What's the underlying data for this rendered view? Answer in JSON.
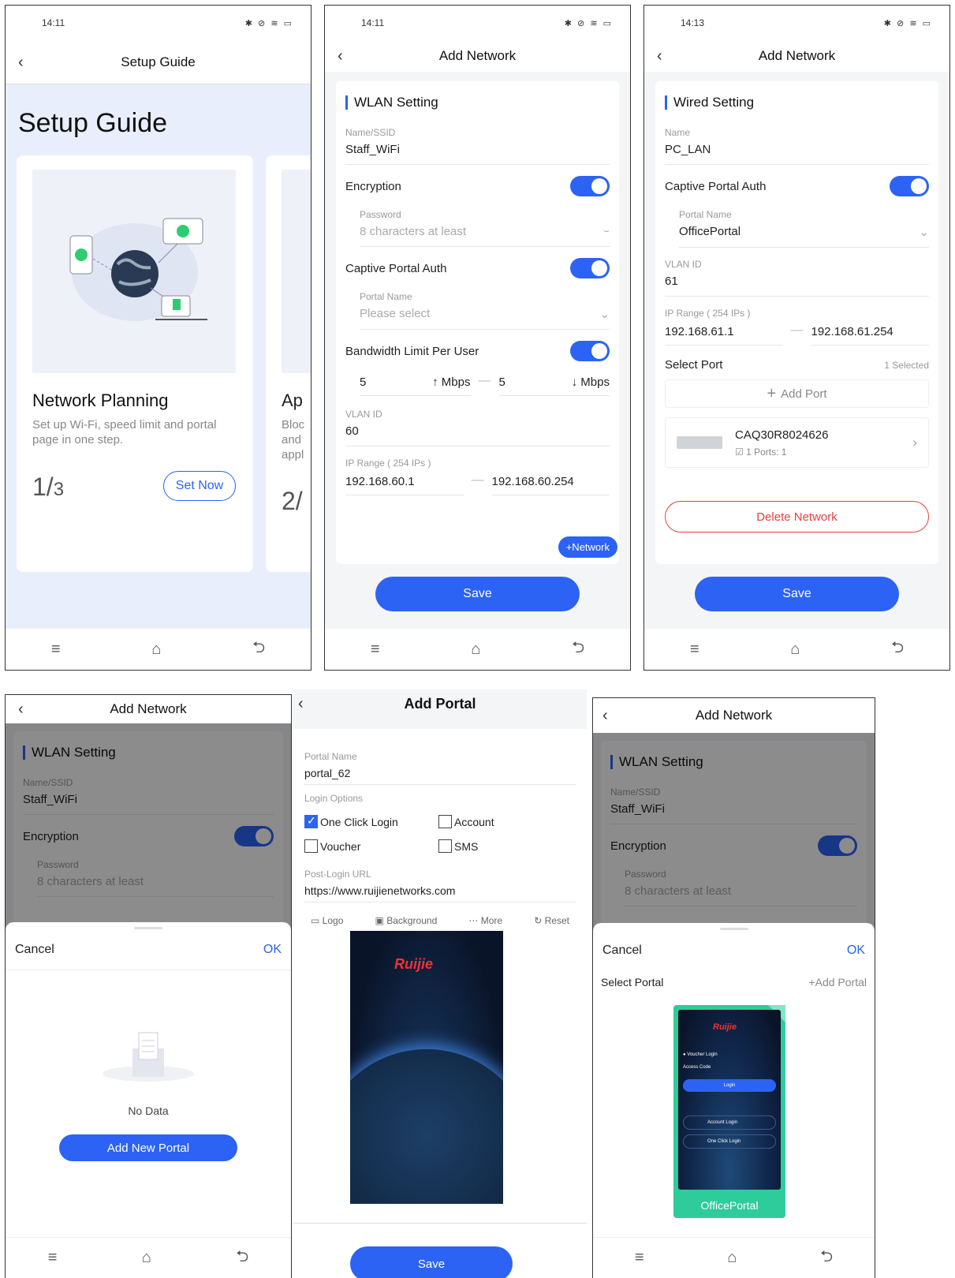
{
  "screen1": {
    "time": "14:11",
    "status_icons": "✱ ⊘ ≋ ▭",
    "title": "Setup Guide",
    "heading": "Setup Guide",
    "card_title": "Network Planning",
    "card_desc": "Set up Wi-Fi, speed limit and portal page in one step.",
    "page": "1/",
    "page_total": "3",
    "button": "Set Now",
    "card2_title": "Ap",
    "card2_desc": "Bloc and appl",
    "card2_page": "2/"
  },
  "screen2": {
    "time": "14:11",
    "status_icons": "✱ ⊘ ≋ ▭",
    "title": "Add Network",
    "section": "WLAN Setting",
    "ssid_label": "Name/SSID",
    "ssid": "Staff_WiFi",
    "encryption": "Encryption",
    "password_label": "Password",
    "password_ph": "8 characters at least",
    "captive": "Captive Portal Auth",
    "portal_label": "Portal Name",
    "portal_ph": "Please select",
    "bandwidth": "Bandwidth Limit Per User",
    "up_val": "5",
    "up_unit": "↑ Mbps",
    "down_val": "5",
    "down_unit": "↓ Mbps",
    "vlan_label": "VLAN ID",
    "vlan": "60",
    "ip_label": "IP Range ( 254  IPs )",
    "ip_start": "192.168.60.1",
    "ip_end": "192.168.60.254",
    "add_network": "+Network",
    "save": "Save"
  },
  "screen3": {
    "time": "14:13",
    "status_icons": "✱ ⊘ ≋ ▭",
    "title": "Add Network",
    "section": "Wired Setting",
    "name_label": "Name",
    "name": "PC_LAN",
    "captive": "Captive Portal Auth",
    "portal_label": "Portal Name",
    "portal": "OfficePortal",
    "vlan_label": "VLAN ID",
    "vlan": "61",
    "ip_label": "IP Range ( 254  IPs )",
    "ip_start": "192.168.61.1",
    "ip_end": "192.168.61.254",
    "select_port": "Select Port",
    "selected": "1 Selected",
    "add_port": "Add Port",
    "device": "CAQ30R8024626",
    "ports": "1 Ports: 1",
    "delete": "Delete Network",
    "save": "Save"
  },
  "screen4": {
    "title": "Add Network",
    "section": "WLAN Setting",
    "ssid_label": "Name/SSID",
    "ssid": "Staff_WiFi",
    "encryption": "Encryption",
    "password_label": "Password",
    "password_ph": "8 characters at least",
    "cancel": "Cancel",
    "ok": "OK",
    "empty": "No Data",
    "add_portal": "Add New Portal"
  },
  "screen5": {
    "title": "Add Portal",
    "portal_label": "Portal Name",
    "portal": "portal_62",
    "login_label": "Login Options",
    "opt1": "One Click Login",
    "opt2": "Account",
    "opt3": "Voucher",
    "opt4": "SMS",
    "url_label": "Post-Login URL",
    "url": "https://www.ruijienetworks.com",
    "tool1": "Logo",
    "tool2": "Background",
    "tool3": "More",
    "tool4": "Reset",
    "brand": "Ruijie",
    "save": "Save"
  },
  "screen6": {
    "title": "Add Network",
    "section": "WLAN Setting",
    "ssid_label": "Name/SSID",
    "ssid": "Staff_WiFi",
    "encryption": "Encryption",
    "password_label": "Password",
    "password_ph": "8 characters at least",
    "cancel": "Cancel",
    "ok": "OK",
    "select_portal": "Select Portal",
    "add_portal": "+Add Portal",
    "voucher_login": "Voucher Login",
    "access_code": "Access Code",
    "login": "Login",
    "account_login": "Account Login",
    "one_click": "One Click Login",
    "portal_name": "OfficePortal",
    "brand": "Ruijie"
  },
  "nav": {
    "menu": "≡",
    "home": "⌂",
    "back": "⮌"
  }
}
